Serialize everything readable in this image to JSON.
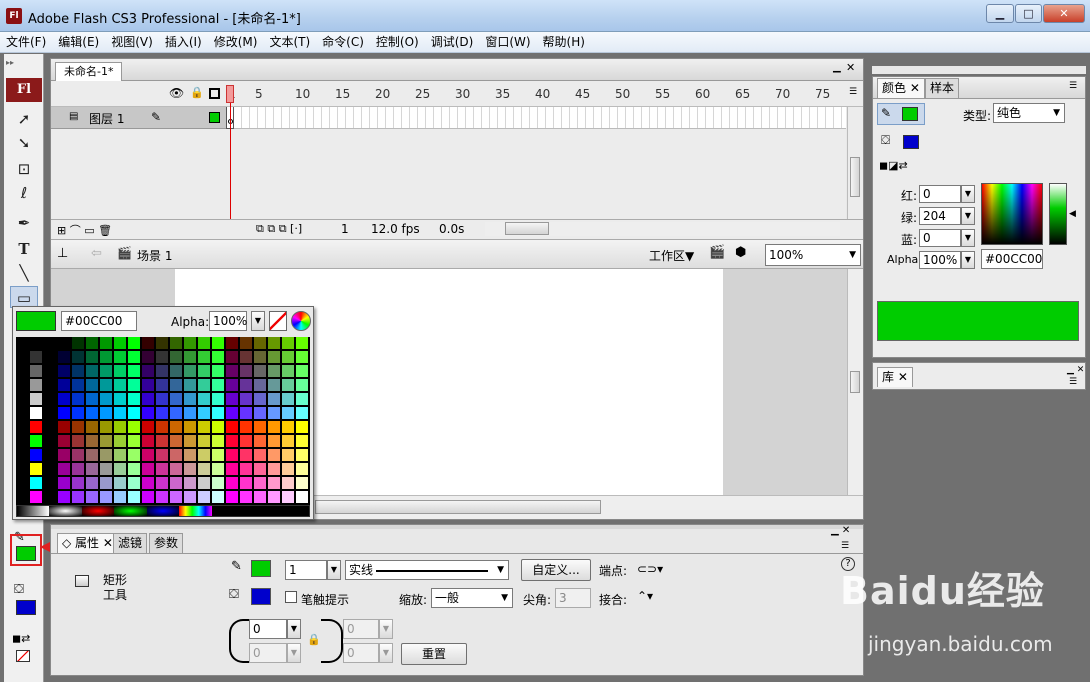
{
  "window": {
    "app_icon": "Fl",
    "title": "Adobe Flash CS3 Professional - [未命名-1*]",
    "buttons": {
      "minimize": "▁",
      "maximize": "□",
      "close": "✕"
    }
  },
  "menu": [
    "文件(F)",
    "编辑(E)",
    "视图(V)",
    "插入(I)",
    "修改(M)",
    "文本(T)",
    "命令(C)",
    "控制(O)",
    "调试(D)",
    "窗口(W)",
    "帮助(H)"
  ],
  "toolbar": {
    "logo": "Fl",
    "tools": [
      {
        "name": "selection-tool",
        "glyph": "➚"
      },
      {
        "name": "subselection-tool",
        "glyph": "➘"
      },
      {
        "name": "free-transform-tool",
        "glyph": "⊡"
      },
      {
        "name": "lasso-tool",
        "glyph": "ℓ"
      },
      {
        "name": "pen-tool",
        "glyph": "✒"
      },
      {
        "name": "text-tool",
        "glyph": "T"
      },
      {
        "name": "line-tool",
        "glyph": "╲"
      },
      {
        "name": "rectangle-tool",
        "glyph": "▭"
      }
    ],
    "stroke_color": "#00CC00",
    "fill_color": "#0000CC"
  },
  "document": {
    "tab": "未命名-1*",
    "frame_numbers": [
      "1",
      "5",
      "10",
      "15",
      "20",
      "25",
      "30",
      "35",
      "40",
      "45",
      "50",
      "55",
      "60",
      "65",
      "70",
      "75"
    ],
    "layer_name": "图层 1",
    "status": {
      "frame": "1",
      "fps": "12.0 fps",
      "time": "0.0s"
    },
    "scene": "场景 1",
    "workspace": "工作区▼",
    "zoom": "100%"
  },
  "swatch_popup": {
    "hex": "#00CC00",
    "alpha_label": "Alpha:",
    "alpha_value": "100%",
    "preview_color": "#00CC00"
  },
  "properties": {
    "tabs": [
      "属性",
      "滤镜",
      "参数"
    ],
    "tool_name_line1": "矩形",
    "tool_name_line2": "工具",
    "stroke_width": "1",
    "stroke_style": "实线",
    "custom_button": "自定义...",
    "cap_label": "端点:",
    "hinting_label": "笔触提示",
    "scale_label": "缩放:",
    "scale_value": "一般",
    "miter_label": "尖角:",
    "miter_value": "3",
    "join_label": "接合:",
    "corner_values": [
      "0",
      "0",
      "0",
      "0"
    ],
    "reset_button": "重置",
    "stroke_color": "#00CC00",
    "fill_color": "#0000CC"
  },
  "color_panel": {
    "tabs": [
      "颜色",
      "样本"
    ],
    "type_label": "类型:",
    "type_value": "纯色",
    "red_label": "红:",
    "red_value": "0",
    "green_label": "绿:",
    "green_value": "204",
    "blue_label": "蓝:",
    "blue_value": "0",
    "alpha_label": "Alpha:",
    "alpha_value": "100%",
    "hex_value": "#00CC00",
    "preview_color": "#00CC00"
  },
  "library_panel": {
    "tab": "库"
  },
  "watermark": {
    "text": "Baidu经验",
    "url": "jingyan.baidu.com"
  }
}
